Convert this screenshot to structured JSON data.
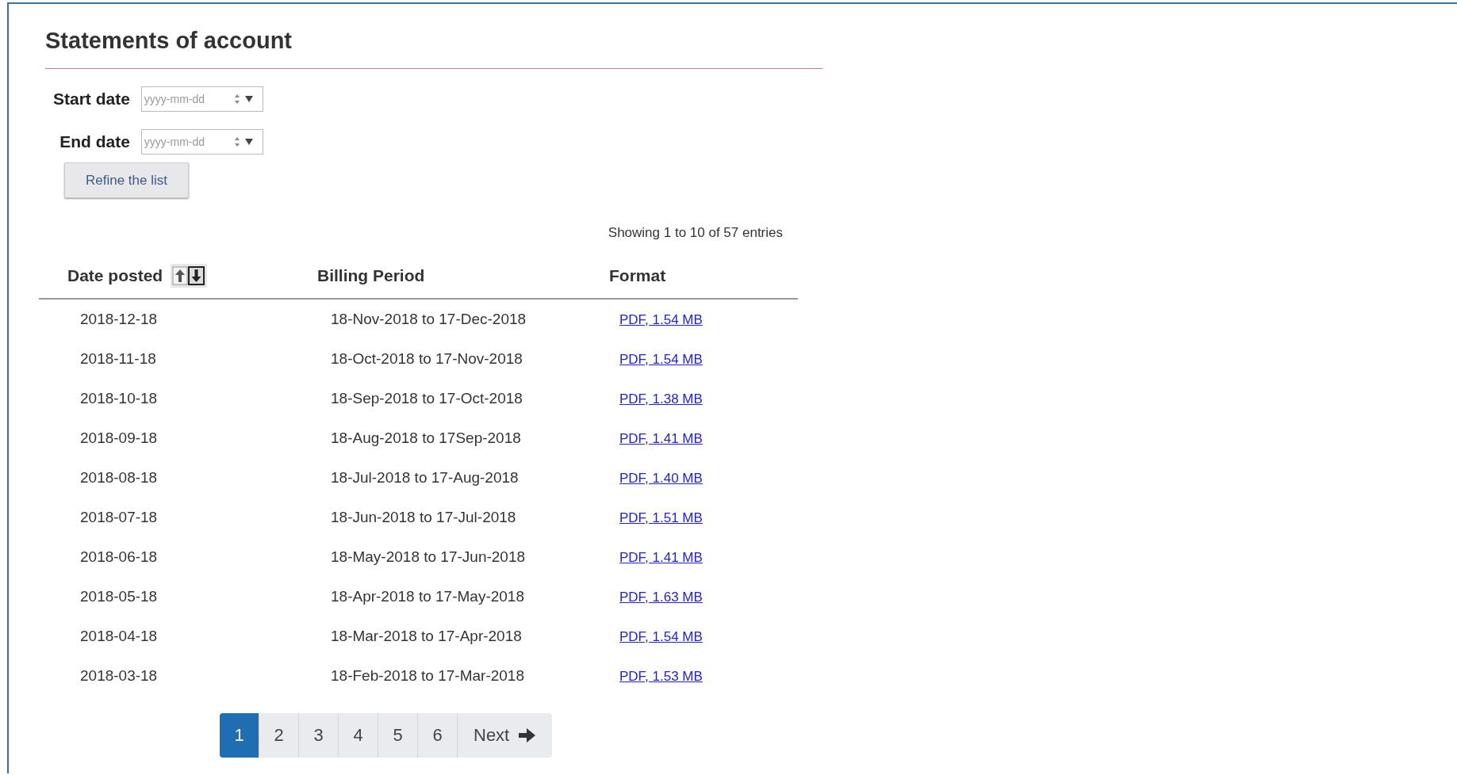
{
  "title": "Statements of account",
  "filters": [
    {
      "label": "Start date",
      "placeholder": "yyyy-mm-dd"
    },
    {
      "label": "End date",
      "placeholder": "yyyy-mm-dd"
    }
  ],
  "refine_button": "Refine the list",
  "summary": "Showing 1 to 10 of 57 entries",
  "table": {
    "columns": [
      {
        "label": "Date posted",
        "sortable": true
      },
      {
        "label": "Billing Period",
        "sortable": false
      },
      {
        "label": "Format",
        "sortable": false
      }
    ],
    "rows": [
      {
        "date": "2018-12-18",
        "period": "18-Nov-2018 to 17-Dec-2018",
        "format": "PDF, 1.54 MB"
      },
      {
        "date": "2018-11-18",
        "period": "18-Oct-2018 to 17-Nov-2018",
        "format": "PDF, 1.54 MB"
      },
      {
        "date": "2018-10-18",
        "period": "18-Sep-2018 to 17-Oct-2018",
        "format": "PDF, 1.38 MB"
      },
      {
        "date": "2018-09-18",
        "period": "18-Aug-2018 to 17Sep-2018",
        "format": "PDF, 1.41 MB"
      },
      {
        "date": "2018-08-18",
        "period": "18-Jul-2018 to 17-Aug-2018",
        "format": "PDF, 1.40 MB"
      },
      {
        "date": "2018-07-18",
        "period": "18-Jun-2018 to 17-Jul-2018",
        "format": "PDF, 1.51 MB"
      },
      {
        "date": "2018-06-18",
        "period": "18-May-2018 to 17-Jun-2018",
        "format": "PDF, 1.41 MB"
      },
      {
        "date": "2018-05-18",
        "period": "18-Apr-2018 to 17-May-2018",
        "format": "PDF, 1.63 MB"
      },
      {
        "date": "2018-04-18",
        "period": "18-Mar-2018 to 17-Apr-2018",
        "format": "PDF, 1.54 MB"
      },
      {
        "date": "2018-03-18",
        "period": "18-Feb-2018 to 17-Mar-2018",
        "format": "PDF, 1.53 MB"
      }
    ]
  },
  "pagination": {
    "pages": [
      {
        "label": "1",
        "selected": true
      },
      {
        "label": "2",
        "selected": false
      },
      {
        "label": "3",
        "selected": false
      },
      {
        "label": "4",
        "selected": false
      },
      {
        "label": "5",
        "selected": false
      },
      {
        "label": "6",
        "selected": false
      }
    ],
    "next": "Next"
  }
}
